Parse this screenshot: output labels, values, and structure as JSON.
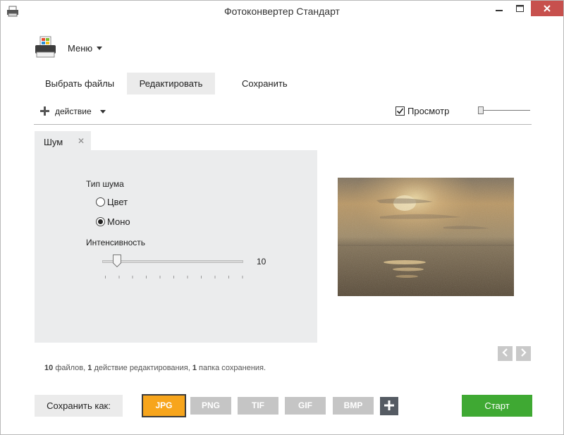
{
  "window": {
    "title": "Фотоконвертер Стандарт",
    "icons": {
      "app": "printer-icon",
      "minimize": "minimize-icon",
      "maximize": "maximize-icon",
      "close": "close-icon"
    }
  },
  "menu": {
    "label": "Меню",
    "icon": "printer-logo-icon"
  },
  "tabs": [
    {
      "label": "Выбрать файлы",
      "active": false
    },
    {
      "label": "Редактировать",
      "active": true
    },
    {
      "label": "Сохранить",
      "active": false
    }
  ],
  "toolbar": {
    "action_label": "действие",
    "preview_label": "Просмотр",
    "preview_checked": true
  },
  "effect_panel": {
    "tab_label": "Шум",
    "noise_type_label": "Тип шума",
    "options": [
      {
        "label": "Цвет",
        "selected": false
      },
      {
        "label": "Моно",
        "selected": true
      }
    ],
    "intensity_label": "Интенсивность",
    "intensity_value": "10"
  },
  "summary": {
    "files_count": "10",
    "files_text": "файлов,",
    "actions_count": "1",
    "actions_text": "действие редактирования,",
    "folders_count": "1",
    "folders_text": "папка сохранения."
  },
  "save": {
    "label": "Сохранить как:",
    "formats": [
      {
        "label": "JPG",
        "active": true
      },
      {
        "label": "PNG",
        "active": false
      },
      {
        "label": "TIF",
        "active": false
      },
      {
        "label": "GIF",
        "active": false
      },
      {
        "label": "BMP",
        "active": false
      }
    ],
    "start_label": "Старт"
  },
  "colors": {
    "accent": "#f7a51c",
    "start": "#3fa933",
    "close": "#c7504d"
  }
}
